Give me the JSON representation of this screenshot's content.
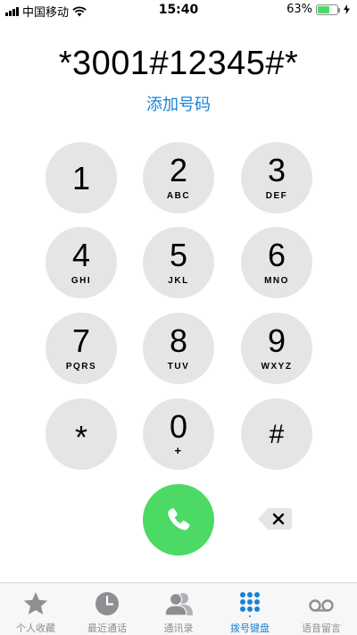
{
  "status_bar": {
    "carrier": "中国移动",
    "time": "15:40",
    "battery_percent": "63%",
    "battery_level": 0.63,
    "icons": [
      "signal-icon",
      "wifi-icon",
      "battery-icon",
      "charging-bolt-icon"
    ]
  },
  "display": {
    "number": "*3001#12345#*",
    "add_number": "添加号码"
  },
  "keypad": [
    {
      "digit": "1",
      "letters": ""
    },
    {
      "digit": "2",
      "letters": "ABC"
    },
    {
      "digit": "3",
      "letters": "DEF"
    },
    {
      "digit": "4",
      "letters": "GHI"
    },
    {
      "digit": "5",
      "letters": "JKL"
    },
    {
      "digit": "6",
      "letters": "MNO"
    },
    {
      "digit": "7",
      "letters": "PQRS"
    },
    {
      "digit": "8",
      "letters": "TUV"
    },
    {
      "digit": "9",
      "letters": "WXYZ"
    },
    {
      "digit": "*",
      "letters": ""
    },
    {
      "digit": "0",
      "letters": "+"
    },
    {
      "digit": "#",
      "letters": ""
    }
  ],
  "actions": {
    "call_icon": "phone-icon",
    "backspace_icon": "backspace-icon",
    "call_color": "#4cd964"
  },
  "tabs": [
    {
      "label": "个人收藏",
      "icon": "star-icon"
    },
    {
      "label": "最近通话",
      "icon": "clock-icon"
    },
    {
      "label": "通讯录",
      "icon": "contacts-icon"
    },
    {
      "label": "拨号键盘",
      "icon": "keypad-icon",
      "active": true
    },
    {
      "label": "语音留言",
      "icon": "voicemail-icon"
    }
  ],
  "colors": {
    "accent": "#1a82d6",
    "key_background": "#e5e5e5",
    "inactive_tab": "#8e8e93"
  }
}
